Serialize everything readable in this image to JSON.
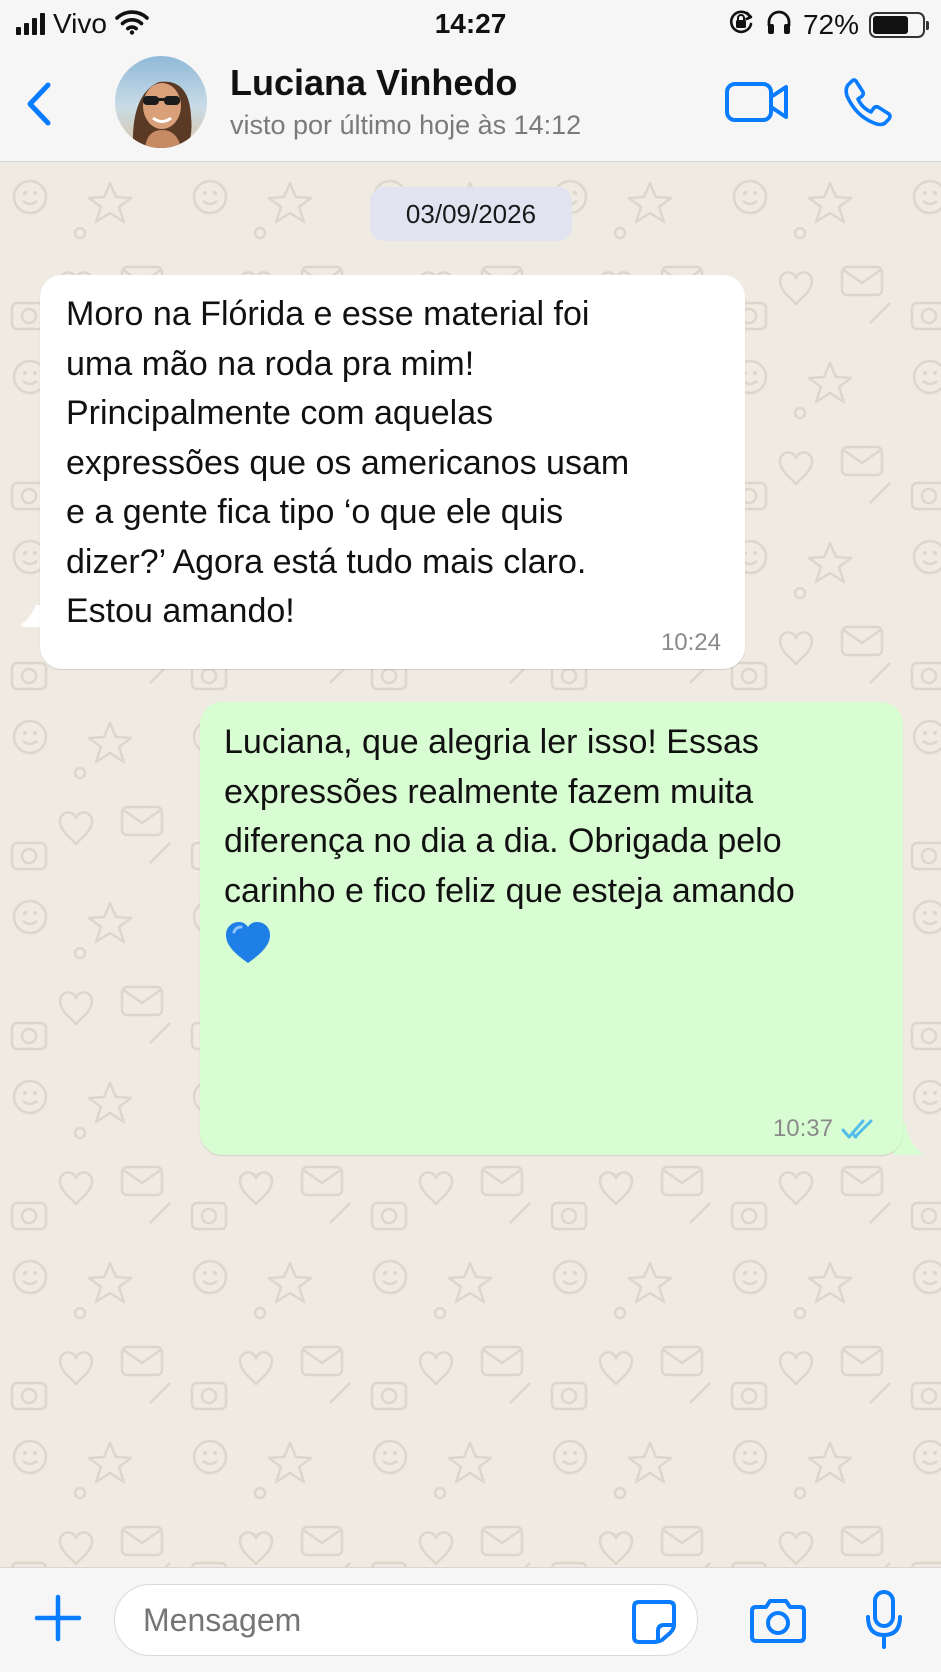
{
  "status_bar": {
    "carrier": "Vivo",
    "time": "14:27",
    "battery_percent": "72%",
    "battery_level": 0.72,
    "icons": [
      "signal-icon",
      "wifi-icon",
      "orientation-lock-icon",
      "headphones-icon",
      "battery-icon"
    ]
  },
  "header": {
    "contact_name": "Luciana Vinhedo",
    "last_seen": "visto por último hoje às 14:12",
    "icons": [
      "back-chevron-icon",
      "video-call-icon",
      "phone-icon"
    ]
  },
  "chat": {
    "date_chip": "03/09/2026",
    "messages": [
      {
        "direction": "incoming",
        "lines": [
          "Moro na Flórida e esse material foi",
          "uma mão na roda pra mim!",
          "Principalmente com aquelas",
          "expressões que os americanos usam",
          "e a gente fica tipo ‘o que ele quis",
          "dizer?’ Agora está tudo mais claro.",
          "Estou amando!"
        ],
        "time": "10:24"
      },
      {
        "direction": "outgoing",
        "lines": [
          "Luciana, que alegria ler isso! Essas",
          "expressões realmente fazem muita",
          "diferença no dia a dia. Obrigada pelo",
          "carinho e fico feliz que esteja amando"
        ],
        "emoji": "blue-heart-icon",
        "time": "10:37",
        "status": "read-double-check-icon"
      }
    ]
  },
  "input_bar": {
    "placeholder": "Mensagem",
    "icons": [
      "plus-icon",
      "sticker-icon",
      "camera-icon",
      "microphone-icon"
    ]
  },
  "colors": {
    "accent": "#0a7cff",
    "incoming_bubble": "#ffffff",
    "outgoing_bubble": "#d9fdd3",
    "chat_background": "#efeae2",
    "read_check": "#53bdeb",
    "heart": "#1e7fe6"
  }
}
